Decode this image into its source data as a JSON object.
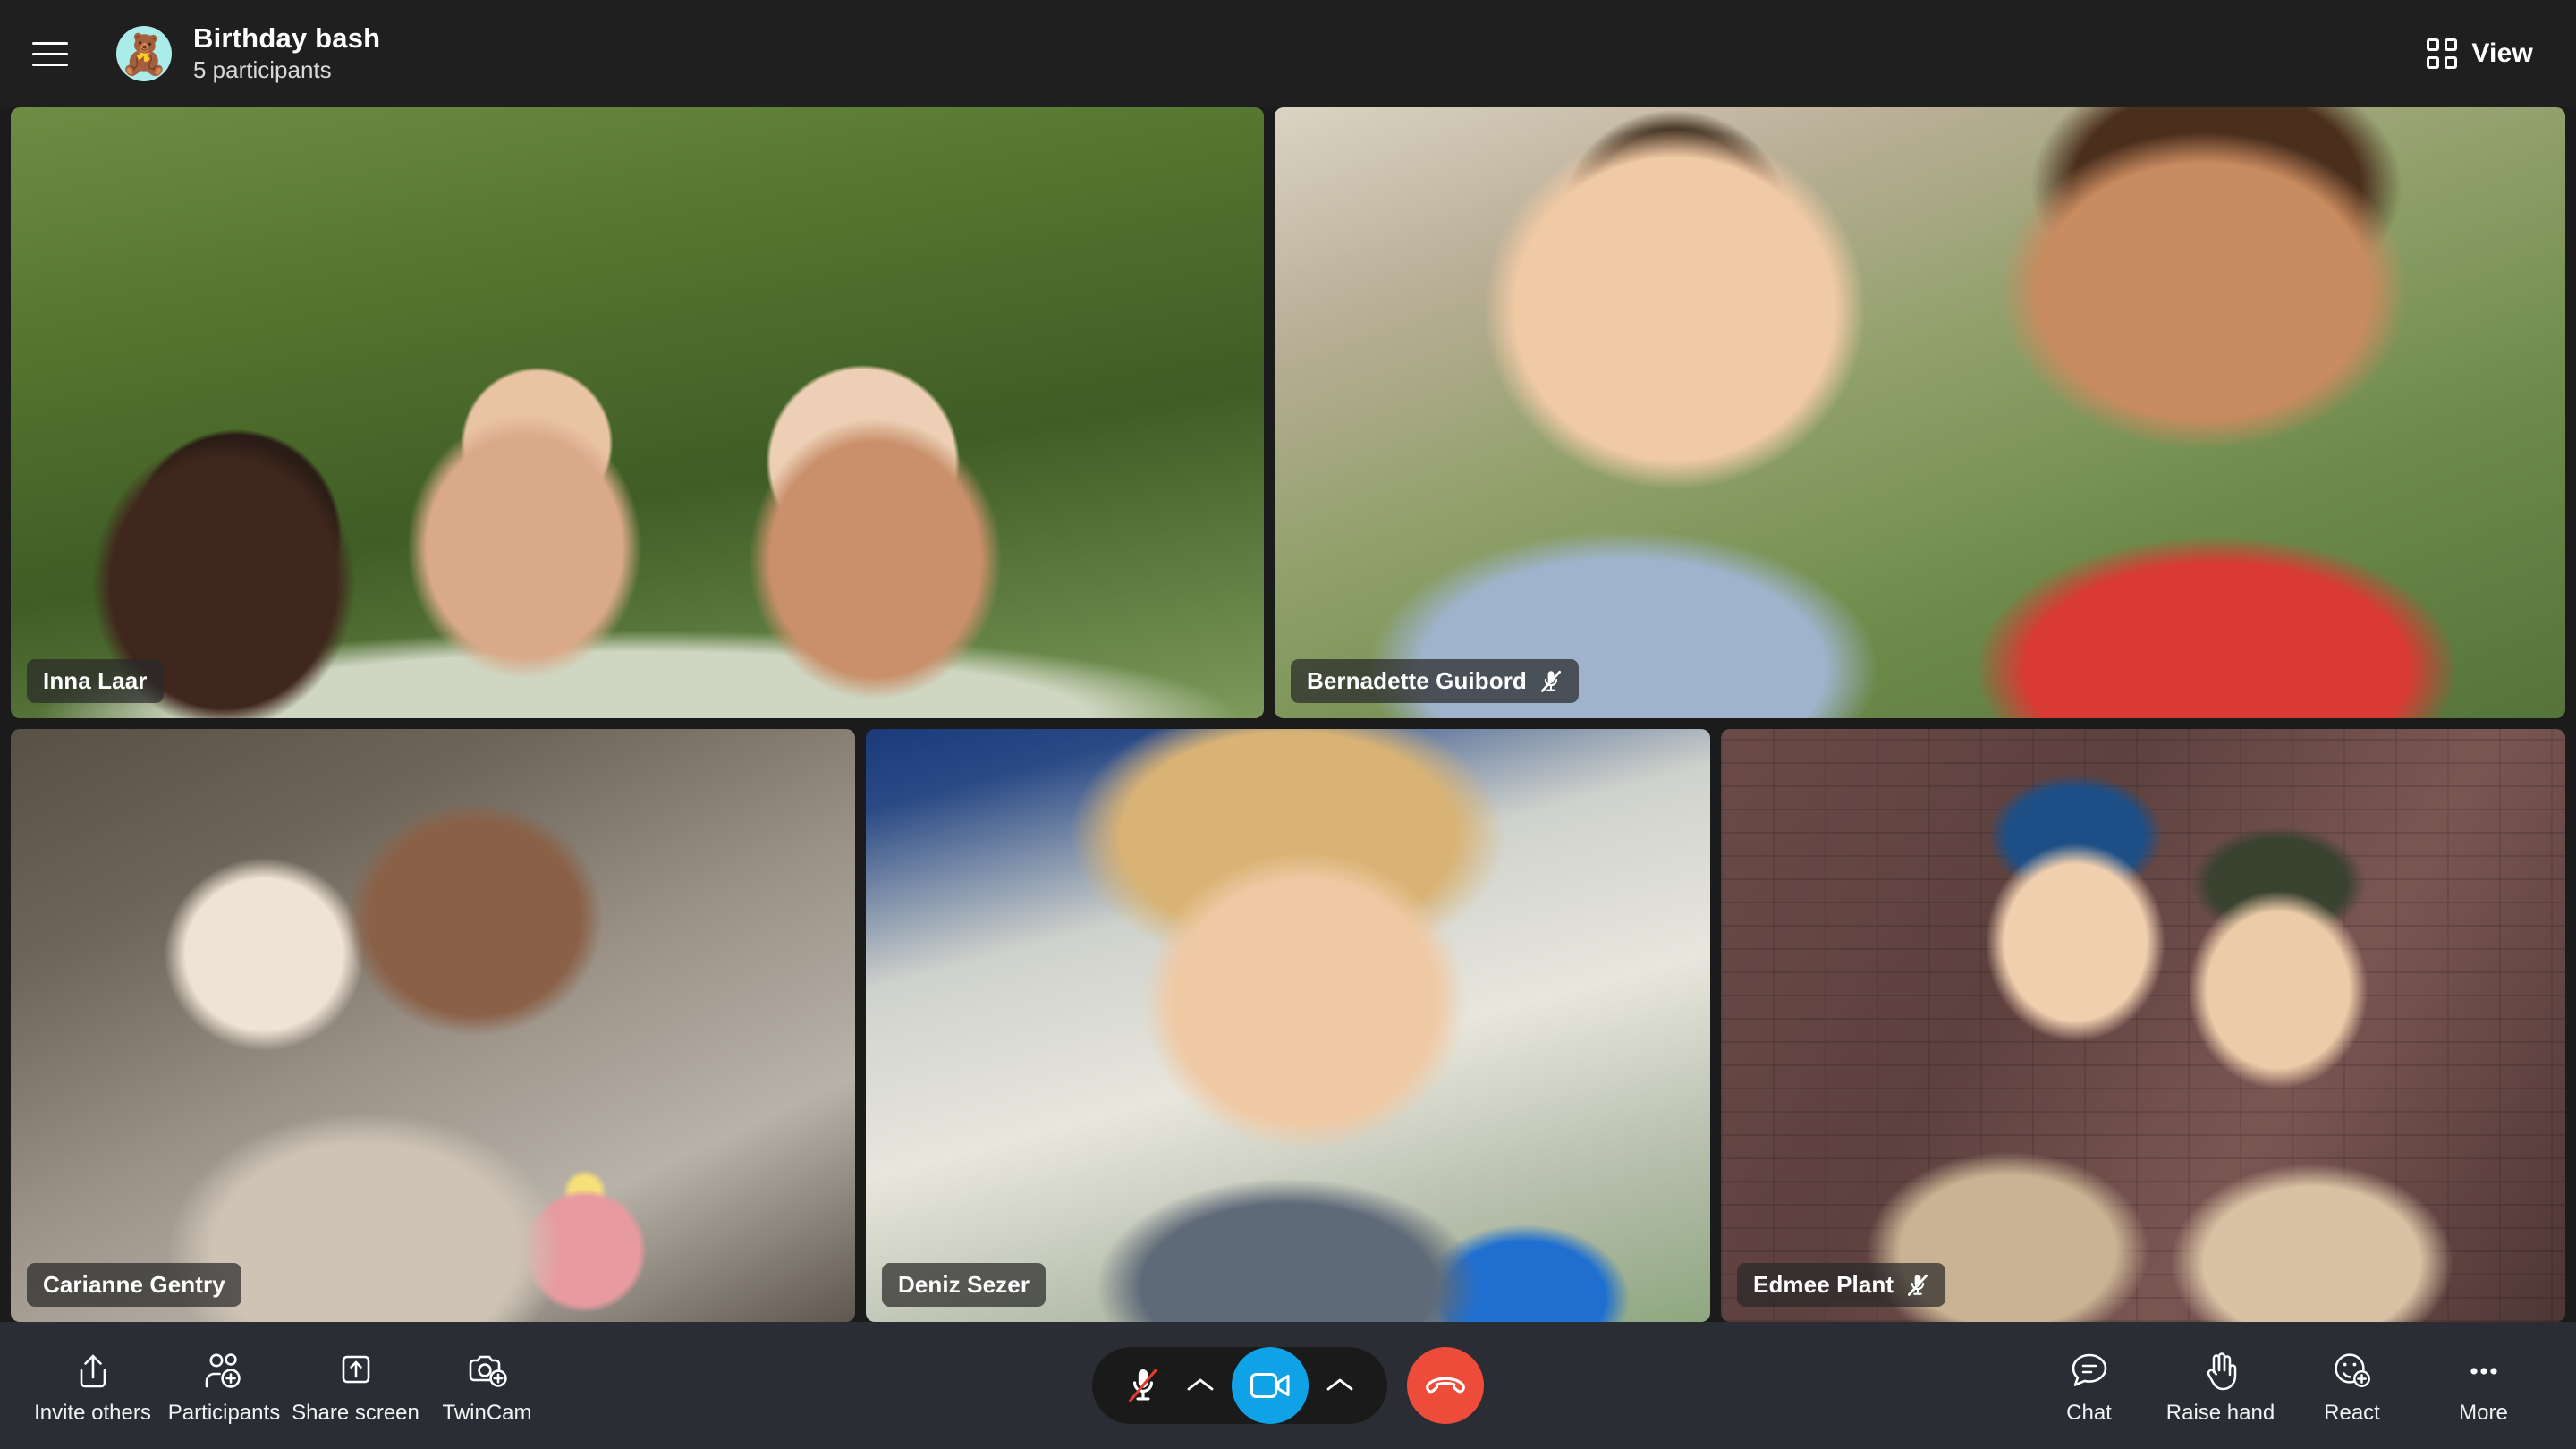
{
  "header": {
    "menu_icon": "hamburger-menu-icon",
    "avatar_icon": "teddy-bear-avatar",
    "avatar_emoji": "🧸",
    "avatar_bg": "#a9ecea",
    "title": "Birthday bash",
    "participants": "5 participants",
    "view_label": "View",
    "view_icon": "grid-view-icon",
    "background": "#1f1f1f"
  },
  "grid": {
    "tiles": [
      {
        "name": "Inna Laar",
        "muted": false,
        "scene": "s1",
        "row": "top",
        "flex": 1.0
      },
      {
        "name": "Bernadette Guibord",
        "muted": true,
        "scene": "s2",
        "row": "top",
        "flex": 1.03
      },
      {
        "name": "Carianne Gentry",
        "muted": false,
        "scene": "s3",
        "row": "bottom",
        "flex": 1.0
      },
      {
        "name": "Deniz Sezer",
        "muted": false,
        "scene": "s4",
        "row": "bottom",
        "flex": 1.0
      },
      {
        "name": "Edmee Plant",
        "muted": true,
        "scene": "s5",
        "row": "bottom",
        "flex": 1.0
      }
    ],
    "mic_off_icon": "mic-off-icon"
  },
  "toolbar": {
    "background": "#2b2d35",
    "left": [
      {
        "label": "Invite others",
        "icon": "share-upload-icon"
      },
      {
        "label": "Participants",
        "icon": "add-person-icon"
      },
      {
        "label": "Share screen",
        "icon": "share-screen-icon"
      },
      {
        "label": "TwinCam",
        "icon": "add-camera-icon"
      }
    ],
    "center": {
      "mic": {
        "icon": "mic-off-icon",
        "state": "muted",
        "slash_color": "#e03b2f"
      },
      "mic_menu": {
        "icon": "chevron-up-icon"
      },
      "camera": {
        "icon": "camera-on-icon",
        "state": "on",
        "color": "#0fa2e6"
      },
      "camera_menu": {
        "icon": "chevron-up-icon"
      },
      "end_call": {
        "icon": "end-call-icon",
        "color": "#ee4c3b"
      }
    },
    "right": [
      {
        "label": "Chat",
        "icon": "chat-bubble-icon"
      },
      {
        "label": "Raise hand",
        "icon": "raise-hand-icon"
      },
      {
        "label": "React",
        "icon": "add-reaction-icon"
      },
      {
        "label": "More",
        "icon": "more-ellipsis-icon"
      }
    ]
  }
}
